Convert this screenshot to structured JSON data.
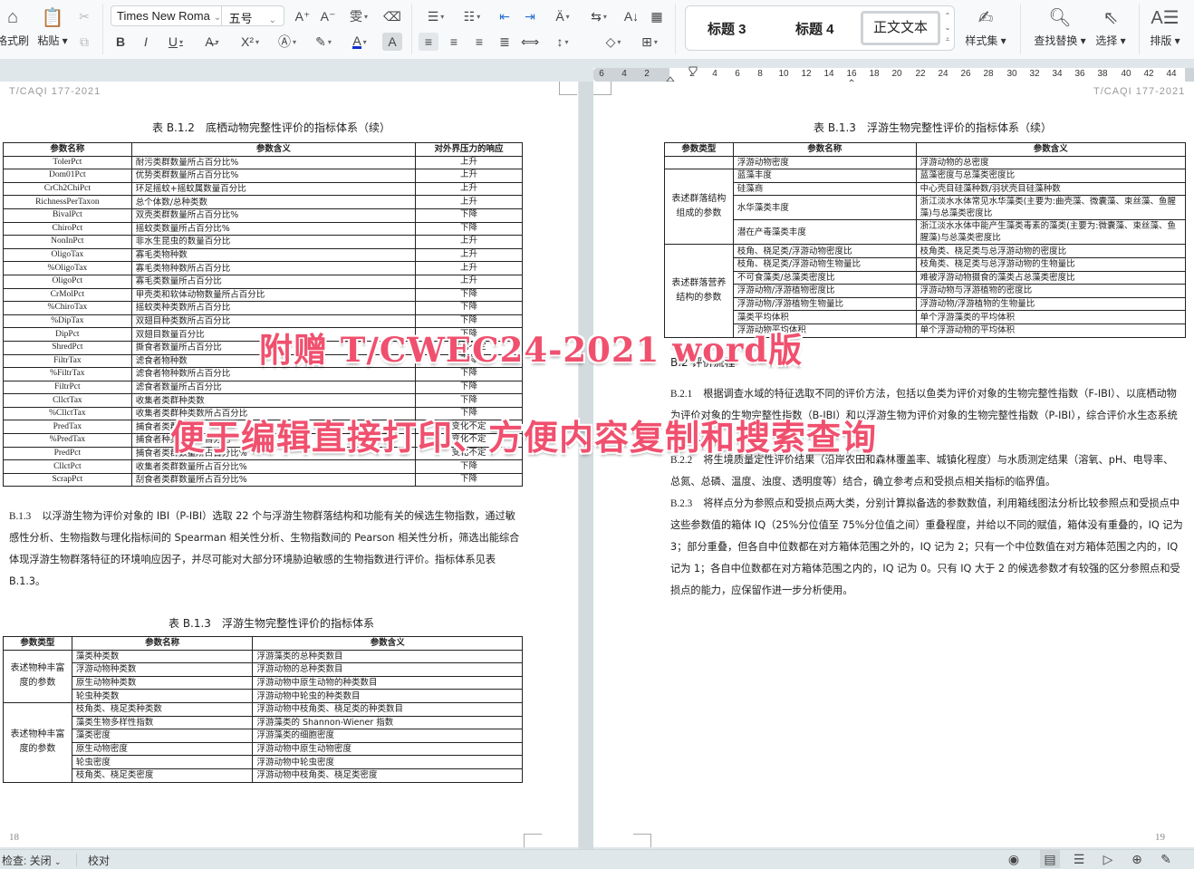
{
  "ribbon": {
    "format_painter": "格式刷",
    "paste": "粘贴",
    "font_name": "Times New Roma",
    "font_size": "五号",
    "styles": [
      "标题 3",
      "标题 4",
      "正文文本"
    ],
    "style_set": "样式集",
    "find_replace": "查找替换",
    "select": "选择",
    "layout": "排版"
  },
  "ruler": {
    "ticks": [
      "6",
      "4",
      "2",
      "2",
      "4",
      "6",
      "8",
      "10",
      "12",
      "14",
      "16",
      "18",
      "20",
      "22",
      "24",
      "26",
      "28",
      "30",
      "32",
      "34",
      "36",
      "38",
      "40",
      "42",
      "44"
    ]
  },
  "left_page": {
    "doc_no": "T/CAQI 177-2021",
    "table1": {
      "caption": "表 B.1.2　底栖动物完整性评价的指标体系（续）",
      "headers": [
        "参数名称",
        "参数含义",
        "对外界压力的响应"
      ],
      "rows": [
        [
          "TolerPct",
          "耐污类群数量所占百分比%",
          "上升"
        ],
        [
          "Dom01Pct",
          "优势类群数量所占百分比%",
          "上升"
        ],
        [
          "CrCh2ChiPct",
          "环足摇蚊+摇蚊属数量百分比",
          "上升"
        ],
        [
          "RichnessPerTaxon",
          "总个体数/总种类数",
          "上升"
        ],
        [
          "BivalPct",
          "双壳类群数量所占百分比%",
          "下降"
        ],
        [
          "ChiroPct",
          "摇蚊类数量所占百分比%",
          "下降"
        ],
        [
          "NonInPct",
          "非水生昆虫的数量百分比",
          "上升"
        ],
        [
          "OligoTax",
          "寡毛类物种数",
          "上升"
        ],
        [
          "%OligoTax",
          "寡毛类物种数所占百分比",
          "上升"
        ],
        [
          "OligoPct",
          "寡毛类数量所占百分比",
          "上升"
        ],
        [
          "CrMolPct",
          "甲壳类和软体动物数量所占百分比",
          "下降"
        ],
        [
          "%ChiroTax",
          "摇蚊类种类数所占百分比",
          "下降"
        ],
        [
          "%DipTax",
          "双翅目种类数所占百分比",
          "下降"
        ],
        [
          "DipPct",
          "双翅目数量百分比",
          "下降"
        ],
        [
          "ShredPct",
          "撕食者数量所占百分比",
          "变化不定"
        ],
        [
          "FiltrTax",
          "滤食者物种数",
          "下降"
        ],
        [
          "%FiltrTax",
          "滤食者物种数所占百分比",
          "下降"
        ],
        [
          "FiltrPct",
          "滤食者数量所占百分比",
          "下降"
        ],
        [
          "CllctTax",
          "收集者类群种类数",
          "下降"
        ],
        [
          "%CllctTax",
          "收集者类群种类数所占百分比",
          "下降"
        ],
        [
          "PredTax",
          "捕食者类群种类数",
          "变化不定"
        ],
        [
          "%PredTax",
          "捕食者种类数所占百分比",
          "变化不定"
        ],
        [
          "PredPct",
          "捕食者类群数量所占百分比%",
          "变化不定"
        ],
        [
          "CllctPct",
          "收集者类群数量所占百分比%",
          "下降"
        ],
        [
          "ScrapPct",
          "刮食者类群数量所占百分比%",
          "下降"
        ]
      ]
    },
    "paragraph_b13": {
      "num": "B.1.3",
      "text": "以浮游生物为评价对象的 IBI（P-IBI）选取 22 个与浮游生物群落结构和功能有关的候选生物指数，通过敏感性分析、生物指数与理化指标间的 Spearman 相关性分析、生物指数间的 Pearson 相关性分析，筛选出能综合体现浮游生物群落特征的环境响应因子，并尽可能对大部分环境胁迫敏感的生物指数进行评价。指标体系见表 B.1.3。"
    },
    "table2": {
      "caption": "表 B.1.3　浮游生物完整性评价的指标体系",
      "headers": [
        "参数类型",
        "参数名称",
        "参数含义"
      ],
      "groups": [
        {
          "category": "表述物种丰富度的参数",
          "rows": [
            [
              "藻类种类数",
              "浮游藻类的总种类数目"
            ],
            [
              "浮游动物种类数",
              "浮游动物的总种类数目"
            ],
            [
              "原生动物种类数",
              "浮游动物中原生动物的种类数目"
            ],
            [
              "轮虫种类数",
              "浮游动物中轮虫的种类数目"
            ]
          ]
        },
        {
          "category": "表述物种丰富度的参数",
          "rows": [
            [
              "枝角类、桡足类种类数",
              "浮游动物中枝角类、桡足类的种类数目"
            ],
            [
              "藻类生物多样性指数",
              "浮游藻类的 Shannon-Wiener 指数"
            ],
            [
              "藻类密度",
              "浮游藻类的细胞密度"
            ],
            [
              "原生动物密度",
              "浮游动物中原生动物密度"
            ],
            [
              "轮虫密度",
              "浮游动物中轮虫密度"
            ],
            [
              "枝角类、桡足类密度",
              "浮游动物中枝角类、桡足类密度"
            ]
          ]
        }
      ]
    },
    "page_number": "18"
  },
  "right_page": {
    "doc_no": "T/CAQI 177-2021",
    "table": {
      "caption": "表 B.1.3　浮游生物完整性评价的指标体系（续）",
      "headers": [
        "参数类型",
        "参数名称",
        "参数含义"
      ],
      "first_row": [
        "",
        "浮游动物密度",
        "浮游动物的总密度"
      ],
      "groups": [
        {
          "category": "表述群落结构组成的参数",
          "rows": [
            [
              "蓝藻丰度",
              "蓝藻密度与总藻类密度比"
            ],
            [
              "硅藻商",
              "中心壳目硅藻种数/羽状壳目硅藻种数"
            ],
            [
              "水华藻类丰度",
              "浙江淡水水体常见水华藻类(主要为:曲壳藻、微囊藻、束丝藻、鱼腥藻)与总藻类密度比"
            ],
            [
              "潜在产毒藻类丰度",
              "浙江淡水水体中能产生藻类毒素的藻类(主要为:微囊藻、束丝藻、鱼腥藻)与总藻类密度比"
            ]
          ]
        },
        {
          "category": "表述群落营养结构的参数",
          "rows": [
            [
              "枝角、桡足类/浮游动物密度比",
              "枝角类、桡足类与总浮游动物的密度比"
            ],
            [
              "枝角、桡足类/浮游动物生物量比",
              "枝角类、桡足类与总浮游动物的生物量比"
            ],
            [
              "不可食藻类/总藻类密度比",
              "难被浮游动物摄食的藻类占总藻类密度比"
            ],
            [
              "浮游动物/浮游植物密度比",
              "浮游动物与浮游植物的密度比"
            ],
            [
              "浮游动物/浮游植物生物量比",
              "浮游动物/浮游植物的生物量比"
            ],
            [
              "藻类平均体积",
              "单个浮游藻类的平均体积"
            ],
            [
              "浮游动物平均体积",
              "单个浮游动物的平均体积"
            ]
          ]
        }
      ]
    },
    "section_b2": "B.2 评价流程",
    "paragraphs": [
      {
        "num": "B.2.1",
        "text": "根据调查水域的特征选取不同的评价方法，包括以鱼类为评价对象的生物完整性指数（F-IBI）、以底栖动物为评价对象的生物完整性指数（B-IBI）和以浮游生物为评价对象的生物完整性指数（P-IBI），综合评价水生态系统健康状况。"
      },
      {
        "num": "B.2.2",
        "text": "将生境质量定性评价结果（沿岸农田和森林覆盖率、城镇化程度）与水质测定结果（溶氧、pH、电导率、总氮、总磷、温度、浊度、透明度等）结合，确立参考点和受损点相关指标的临界值。"
      },
      {
        "num": "B.2.3",
        "text": "将样点分为参照点和受损点两大类，分别计算拟备选的参数数值，利用箱线图法分析比较参照点和受损点中这些参数值的箱体 IQ（25%分位值至 75%分位值之间）重叠程度，并给以不同的赋值，箱体没有重叠的，IQ 记为 3；部分重叠，但各自中位数都在对方箱体范围之外的，IQ 记为 2；只有一个中位数值在对方箱体范围之内的，IQ 记为 1；各自中位数都在对方箱体范围之内的，IQ 记为 0。只有 IQ 大于 2 的候选参数才有较强的区分参照点和受损点的能力，应保留作进一步分析使用。"
      }
    ],
    "page_number": "19"
  },
  "overlay": {
    "line1": "附赠 T/CWEC24-2021 word版",
    "line2": "便于编辑直接打印、方便内容复制和搜索查询",
    "color": "#f0506e"
  },
  "statusbar": {
    "check": "检查: 关闭",
    "proofread": "校对"
  }
}
